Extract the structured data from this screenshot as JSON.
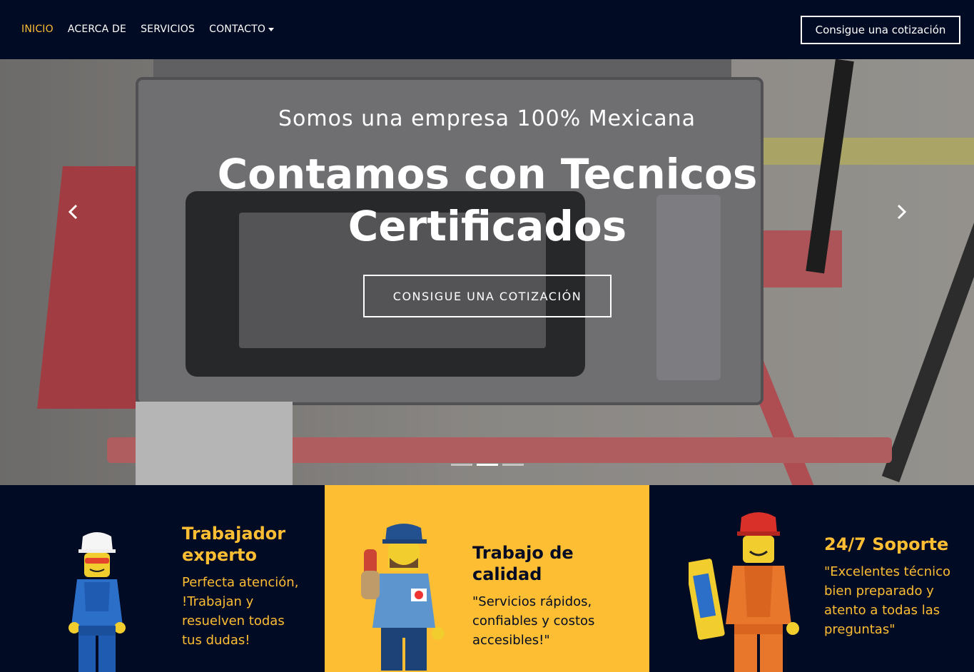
{
  "nav": {
    "links": [
      "INICIO",
      "ACERCA DE",
      "SERVICIOS",
      "CONTACTO"
    ],
    "quote_button": "Consigue una cotización"
  },
  "hero": {
    "subtitle": "Somos una empresa 100% Mexicana",
    "title": "Contamos con Tecnicos Certificados",
    "button": "CONSIGUE UNA COTIZACIÓN",
    "active_slide": 2,
    "slide_count": 3
  },
  "features": [
    {
      "title": "Trabajador experto",
      "text": "Perfecta atención, !Trabajan y resuelven todas tus dudas!"
    },
    {
      "title": "Trabajo de calidad",
      "text": "\"Servicios rápidos, confiables y costos accesibles!\""
    },
    {
      "title": "24/7 Soporte",
      "text": "\"Excelentes técnico bien preparado y atento a todas las preguntas\""
    }
  ],
  "colors": {
    "navy": "#020b24",
    "accent": "#fdbe33",
    "white": "#ffffff"
  },
  "icons": {
    "prev": "chevron-left-icon",
    "next": "chevron-right-icon",
    "dropdown": "caret-down-icon"
  }
}
